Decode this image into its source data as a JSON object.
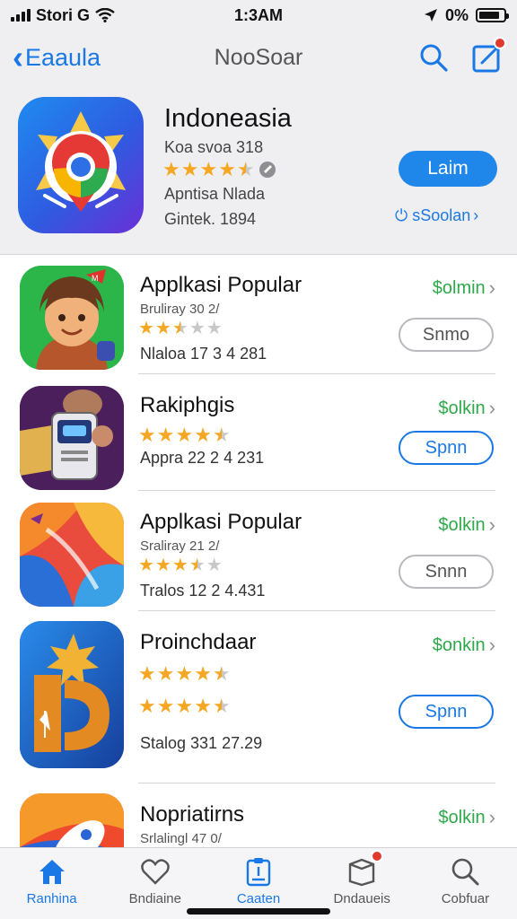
{
  "status_bar": {
    "carrier": "Stori G",
    "time": "1:3AM",
    "battery_percent": "0%"
  },
  "nav": {
    "back_label": "Eaaula",
    "title": "NooSoar"
  },
  "featured": {
    "name": "Indoneasia",
    "subtitle": "Koa svoa 318",
    "rating": 4.5,
    "developer": "Apntisa Nlada",
    "date": "Gintek. 1894",
    "button_label": "Laim",
    "link_label": "⏻ sSoolan"
  },
  "apps": [
    {
      "name": "Applkasi Popular",
      "subtitle": "Bruliray 30 2/",
      "rating": 2.5,
      "meta": "Nlaloa 17 3 4 281",
      "price": "$olmin",
      "action_label": "Snmo",
      "action_style": "grey"
    },
    {
      "name": "Rakiphgis",
      "subtitle": "",
      "rating": 4.5,
      "meta": "Appra 22 2 4 231",
      "price": "$olkin",
      "action_label": "Spnn",
      "action_style": "blue"
    },
    {
      "name": "Applkasi Popular",
      "subtitle": "Sraliray 21 2/",
      "rating": 3.5,
      "meta": "Tralos 12 2 4.431",
      "price": "$olkin",
      "action_label": "Snnn",
      "action_style": "grey"
    },
    {
      "name": "Proinchdaar",
      "subtitle": "",
      "rating": 4.5,
      "rating2": 4.5,
      "meta": "Stalog 331 27.29",
      "price": "$onkin",
      "action_label": "Spnn",
      "action_style": "blue"
    },
    {
      "name": "Nopriatirns",
      "subtitle": "Srlalingl 47 0/",
      "rating": 0,
      "meta": "",
      "price": "$olkin",
      "action_label": "",
      "action_style": ""
    }
  ],
  "tabs": [
    {
      "label": "Ranhina",
      "icon": "home-icon",
      "active": true
    },
    {
      "label": "Bndiaine",
      "icon": "heart-icon",
      "active": false
    },
    {
      "label": "Caaten",
      "icon": "clipboard-icon",
      "active": true
    },
    {
      "label": "Dndaueis",
      "icon": "box-icon",
      "active": false
    },
    {
      "label": "Cobfuar",
      "icon": "search-icon",
      "active": false
    }
  ],
  "colors": {
    "accent": "#1a78e6",
    "price": "#2fa84a",
    "star": "#f5a623",
    "badge": "#e23b2e"
  }
}
